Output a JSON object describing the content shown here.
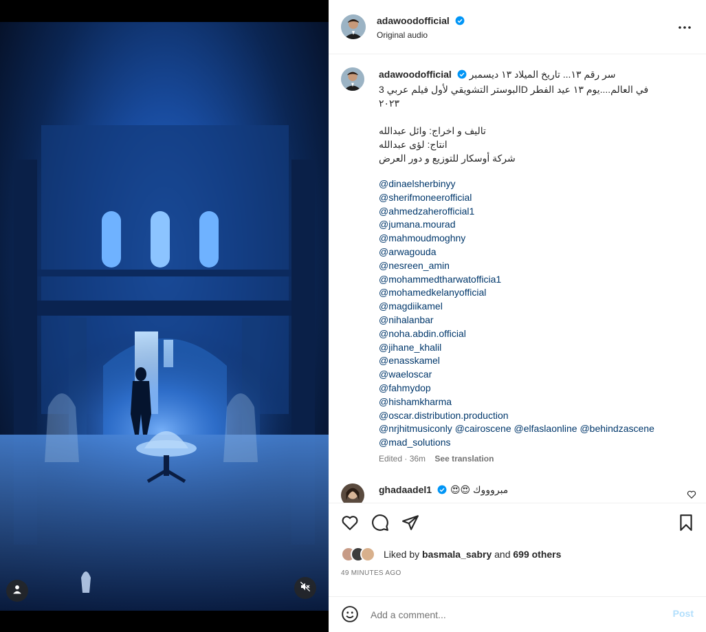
{
  "post": {
    "author": "adawoodofficial",
    "audio": "Original audio",
    "more_label": "More options"
  },
  "caption": {
    "author": "adawoodofficial",
    "line1": "سر رقم ١٣... تاريخ الميلاد ١٣ ديسمبر",
    "line2": "في العالم....يوم ١٣ عيد الفطر Dالبوستر التشويقي لأول فيلم عربي 3",
    "line3": "٢٠٢٣",
    "credits": [
      "تاليف و اخراج: وائل عبدالله",
      "انتاج: لؤى عبدالله",
      "شركة أوسكار للتوزيع و دور العرض"
    ],
    "mentions": [
      "@dinaelsherbinyy",
      "@sherifmoneerofficial",
      "@ahmedzaherofficial1",
      "@jumana.mourad",
      "@mahmoudmoghny",
      "@arwagouda",
      "@nesreen_amin",
      "@mohammedtharwatofficia1",
      "@mohamedkelanyofficial",
      "@magdiikamel",
      "@nihalanbar",
      "@noha.abdin.official",
      "@jihane_khalil",
      "@enasskamel",
      "@waeloscar",
      "@fahmydop",
      "@hishamkharma",
      "@oscar.distribution.production"
    ],
    "mentions_inline": [
      "@nrjhitmusiconly",
      "@cairoscene",
      "@elfaslaonline",
      "@behindzascene"
    ],
    "mention_last": "@mad_solutions",
    "edited": "Edited · 36m",
    "see_translation": "See translation"
  },
  "comment": {
    "author": "ghadaadel1",
    "text": "مبروووك 😍😍"
  },
  "likes": {
    "prefix": "Liked by",
    "user": "basmala_sabry",
    "middle": "and",
    "others": "699 others"
  },
  "time_ago": "49 MINUTES AGO",
  "add_comment": {
    "placeholder": "Add a comment...",
    "post_label": "Post"
  },
  "colors": {
    "verified": "#0095f6",
    "mention": "#00376b",
    "post_disabled": "#b2dffc",
    "video_glow": "#2a6fd6"
  },
  "icons": [
    "user-icon",
    "mute-icon",
    "verified-icon",
    "more-icon",
    "heart-icon",
    "comment-icon",
    "share-icon",
    "save-icon",
    "emoji-icon"
  ]
}
